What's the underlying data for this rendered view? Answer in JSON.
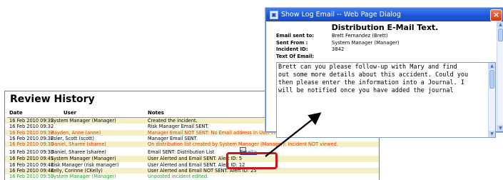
{
  "review": {
    "title": "Review History",
    "columns": {
      "date": "Date",
      "user": "User",
      "notes": "Notes"
    },
    "rows": [
      {
        "date": "16 Feb 2010 09:32",
        "user": "System Manager (Manager)",
        "notes": "Created the incident.",
        "style": "normal"
      },
      {
        "date": "16 Feb 2010 09:32",
        "user": "",
        "notes": "Risk Manager Email SENT.",
        "style": "normal"
      },
      {
        "date": "16 Feb 2010 09:32",
        "user": "Hayden, Anne (anne)",
        "notes": "Manager Email NOT SENT: No Email address in User Profile.",
        "style": "red"
      },
      {
        "date": "16 Feb 2010 09:32",
        "user": "Esler, Scott (scott)",
        "notes": "Manager Email SENT.",
        "style": "normal"
      },
      {
        "date": "16 Feb 2010 09:33",
        "user": "Daniel, Sharee (sharee)",
        "notes": "On distribution list created by System Manager (Manager): Incident NOT viewed.",
        "style": "red"
      },
      {
        "date": "16 Feb 2010 09:33",
        "user": "Daniel, Sharee (sharee)",
        "notes": "Email SENT: Distribution List",
        "link": "Email>",
        "style": "normal"
      },
      {
        "date": "16 Feb 2010 09:41",
        "user": "System Manager (Manager)",
        "notes": "User Alerted and Email SENT. Alert ID: 5",
        "style": "normal"
      },
      {
        "date": "16 Feb 2010 09:42",
        "user": "Risk Manager (risk manager)",
        "notes": "User Alerted and Email SENT. Alert ID: 12",
        "style": "normal"
      },
      {
        "date": "16 Feb 2010 09:42",
        "user": "Kelly, Corinne (CKelly)",
        "notes": "User Alerted and Email NOT SENT. Alert ID: 25",
        "style": "normal"
      },
      {
        "date": "16 Feb 2010 09:50",
        "user": "System Manager (Manager)",
        "notes": "Unposted incident edited.",
        "style": "green"
      }
    ]
  },
  "dialog": {
    "title": "Show Log Email -- Web Page Dialog",
    "close_label": "×",
    "heading": "Distribution E-Mail Text.",
    "fields": {
      "sent_to_label": "Email sent to:",
      "sent_to_value": "Brett Fernandez (Brett)",
      "sent_from_label": "Sent From :",
      "sent_from_value": "System Manager (Manager)",
      "incident_label": "Incident ID:",
      "incident_value": "3842",
      "text_label": "Text Of Email:"
    },
    "email_text": "Brett can you please follow-up with Mary and find\nout some more details about this accident. Could you\nthen please enter the information into a Journal. I\nwill be notified once you have added the journal"
  },
  "colors": {
    "red_text": "#e0340c",
    "green_text": "#2e9a2e",
    "odd_row": "#f4f0c8",
    "highlight": "#c4181c",
    "titlebar": "#1d57d6"
  },
  "icons": {
    "dialog_icon": "window-icon",
    "close": "close-icon",
    "email": "envelope-icon",
    "arrow": "arrow-pointer"
  }
}
